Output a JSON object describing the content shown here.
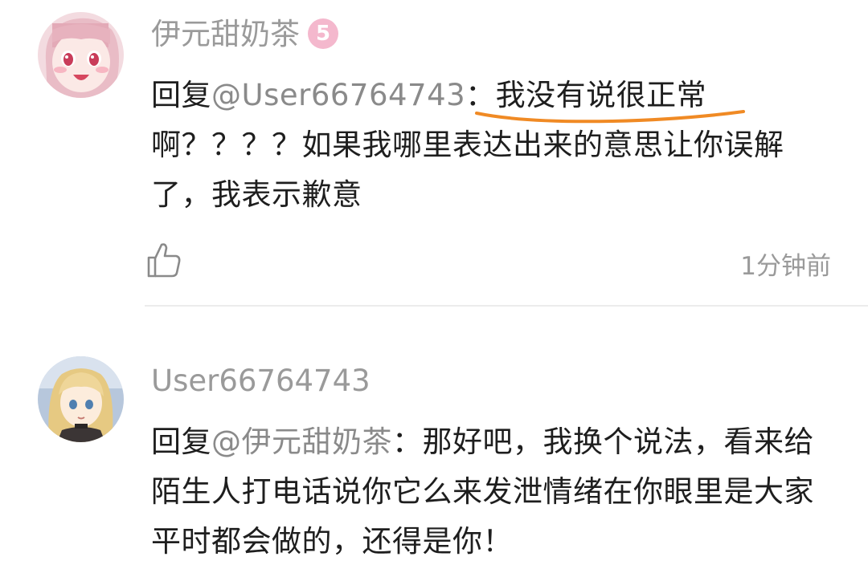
{
  "comments": [
    {
      "username": "伊元甜奶茶",
      "level": "5",
      "reply_prefix": "回复",
      "reply_to": "@User66764743",
      "colon": "：",
      "highlighted_text": "我没有说很正常",
      "rest_text": "啊？？？？如果我哪里表达出来的意思让你误解了，我表示歉意",
      "timestamp": "1分钟前",
      "highlight_color": "#f08a24"
    },
    {
      "username": "User66764743",
      "reply_prefix": "回复",
      "reply_to": "@伊元甜奶茶",
      "text": "：那好吧，我换个说法，看来给陌生人打电话说你它么来发泄情绪在你眼里是大家平时都会做的，还得是你！"
    }
  ],
  "icons": {
    "like": "thumbs-up-icon"
  }
}
